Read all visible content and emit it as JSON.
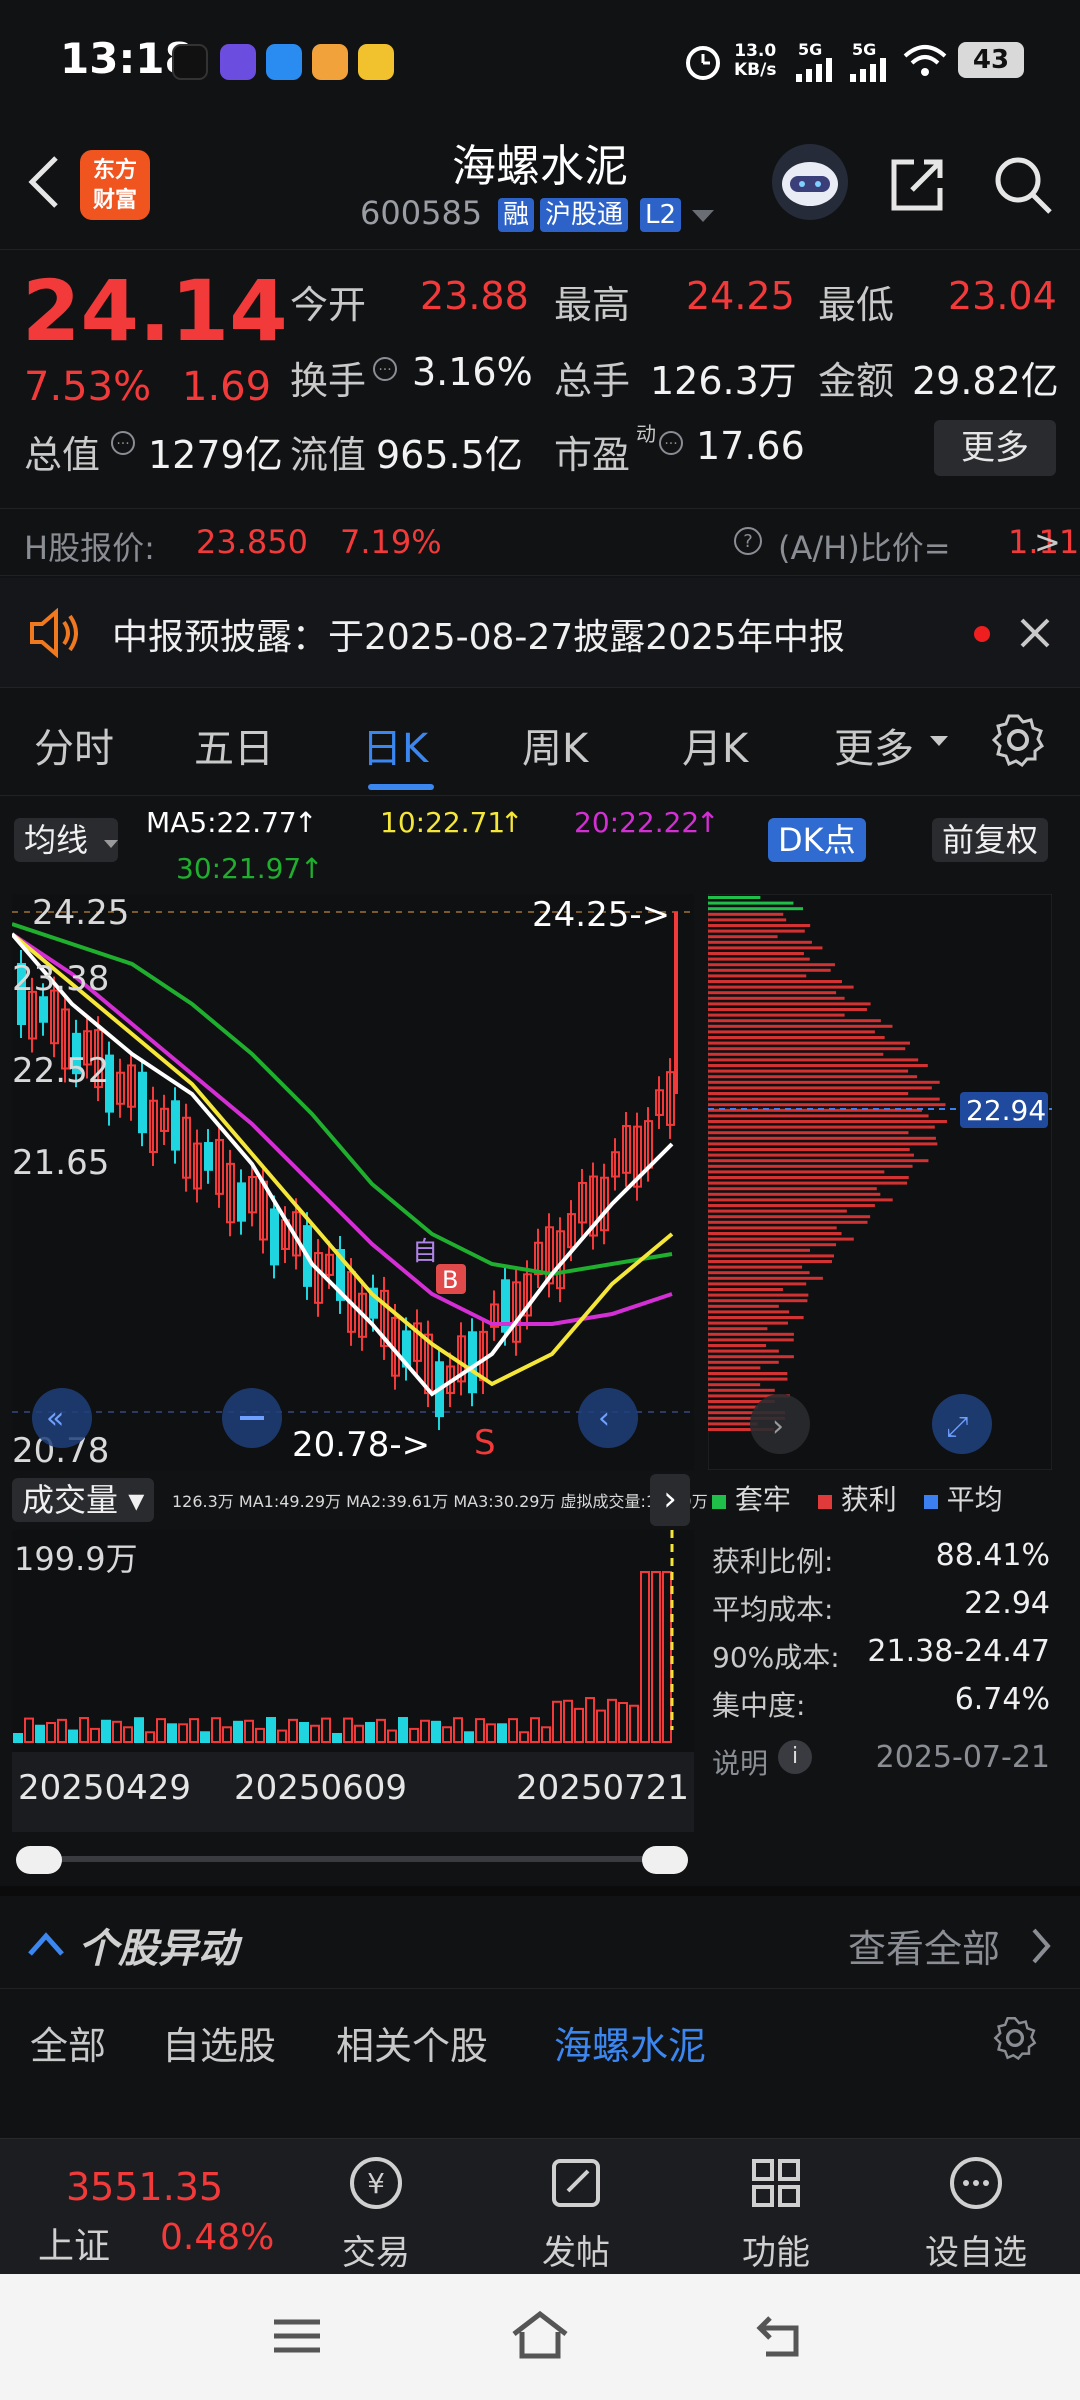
{
  "status_bar": {
    "time": "13:18",
    "net_speed": "13.0",
    "net_unit": "KB/s",
    "signal1": "5G",
    "signal2": "5G",
    "battery": "43"
  },
  "header": {
    "logo_text_1": "东方",
    "logo_text_2": "财富",
    "name": "海螺水泥",
    "code": "600585",
    "tags": [
      "融",
      "沪股通",
      "L2"
    ]
  },
  "quote": {
    "price": "24.14",
    "change_pct": "7.53%",
    "change": "1.69",
    "open_label": "今开",
    "open": "23.88",
    "high_label": "最高",
    "high": "24.25",
    "low_label": "最低",
    "low": "23.04",
    "turnover_label": "换手",
    "turnover": "3.16%",
    "volume_label": "总手",
    "volume": "126.3万",
    "amount_label": "金额",
    "amount": "29.82亿",
    "mcap_label": "总值",
    "mcap": "1279亿",
    "float_label": "流值",
    "float": "965.5亿",
    "pe_label": "市盈",
    "pe_sup": "动",
    "pe": "17.66",
    "more": "更多"
  },
  "h_share": {
    "label": "H股报价:",
    "price": "23.850",
    "pct": "7.19%",
    "ratio_label": "(A/H)比价=",
    "ratio": "1.11",
    "arrow": ">"
  },
  "notice": {
    "text": "中报预披露：于2025-08-27披露2025年中报"
  },
  "tabs": [
    "分时",
    "五日",
    "日K",
    "周K",
    "月K",
    "更多"
  ],
  "active_tab": "日K",
  "ma": {
    "selector": "均线",
    "ma5": "MA5:22.77",
    "ma10": "10:22.71",
    "ma20": "20:22.22",
    "ma30": "30:21.97",
    "dk_button": "DK点",
    "adjust_button": "前复权",
    "colors": {
      "ma5": "#ffffff",
      "ma10": "#f5e63a",
      "ma20": "#d42fd4",
      "ma30": "#1fae2e"
    }
  },
  "kchart": {
    "y_labels": [
      "24.25",
      "23.38",
      "22.52",
      "21.65",
      "20.78"
    ],
    "high_marker": "24.25->",
    "low_marker": "20.78->",
    "markers": {
      "b": "B",
      "s": "S",
      "self": "自"
    }
  },
  "chip": {
    "avg_cost_label": "22.94",
    "legend": [
      "套牢",
      "获利",
      "平均"
    ],
    "legend_colors": [
      "#1fbf4a",
      "#e03a3a",
      "#3c7ff0"
    ],
    "stats": [
      {
        "label": "获利比例:",
        "value": "88.41%"
      },
      {
        "label": "平均成本:",
        "value": "22.94"
      },
      {
        "label": "90%成本:",
        "value": "21.38-24.47"
      },
      {
        "label": "集中度:",
        "value": "6.74%"
      }
    ],
    "note_label": "说明",
    "date": "2025-07-21"
  },
  "volume": {
    "selector": "成交量",
    "values_line": "126.3万  MA1:49.29万  MA2:39.61万  MA3:30.29万  虚拟成交量:199.9万",
    "max_label": "199.9万"
  },
  "dates": [
    "20250429",
    "20250609",
    "20250721"
  ],
  "movers": {
    "title": "个股异动",
    "view_all": "查看全部",
    "subtabs": [
      "全部",
      "自选股",
      "相关个股",
      "海螺水泥"
    ],
    "active_subtab": "海螺水泥"
  },
  "bottom_bar": {
    "index_value": "3551.35",
    "index_name": "上证",
    "index_pct": "0.48%",
    "items": [
      "交易",
      "发帖",
      "功能",
      "设自选"
    ]
  }
}
